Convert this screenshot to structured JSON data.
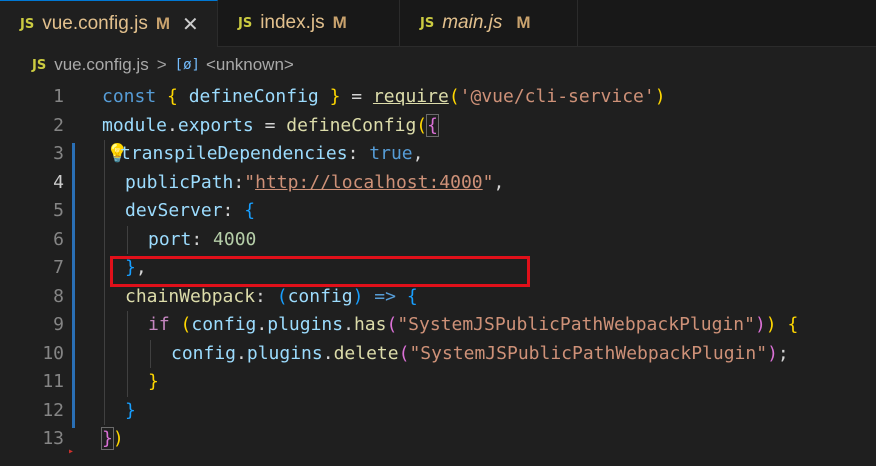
{
  "tabs": [
    {
      "icon": "JS",
      "name": "vue.config.js",
      "status": "M",
      "active": true
    },
    {
      "icon": "JS",
      "name": "index.js",
      "status": "M"
    },
    {
      "icon": "JS",
      "name": "main.js",
      "status": "M"
    }
  ],
  "breadcrumb": {
    "icon": "JS",
    "file": "vue.config.js",
    "separator": ">",
    "symbol_icon": "[ø]",
    "symbol": "<unknown>"
  },
  "lines": {
    "l1": {
      "n": "1",
      "a": "const",
      "b": " ",
      "c": "{",
      "d": " defineConfig ",
      "e": "}",
      "f": " = ",
      "g": "require",
      "h": "(",
      "i": "'@vue/cli-service'",
      "j": ")"
    },
    "l2": {
      "n": "2",
      "a": "module",
      "b": ".",
      "c": "exports",
      "d": " = ",
      "e": "defineConfig",
      "f": "(",
      "g": "{"
    },
    "l3": {
      "n": "3",
      "a": "transpileDependencies",
      "b": ": ",
      "c": "true",
      "d": ","
    },
    "l4": {
      "n": "4",
      "a": "publicPath",
      "b": ":",
      "c": "\"",
      "d": "http://localhost:4000",
      "e": "\"",
      "f": ","
    },
    "l5": {
      "n": "5",
      "a": "devServer",
      "b": ": ",
      "c": "{"
    },
    "l6": {
      "n": "6",
      "a": "port",
      "b": ": ",
      "c": "4000"
    },
    "l7": {
      "n": "7",
      "a": "}",
      "b": ","
    },
    "l8": {
      "n": "8",
      "a": "chainWebpack",
      "b": ": ",
      "c": "(",
      "d": "config",
      "e": ")",
      "f": " => ",
      "g": "{"
    },
    "l9": {
      "n": "9",
      "a": "if",
      "b": " ",
      "c": "(",
      "d": "config",
      "e": ".",
      "f": "plugins",
      "g": ".",
      "h": "has",
      "i": "(",
      "j": "\"SystemJSPublicPathWebpackPlugin\"",
      "k": ")",
      "l": ")",
      "m": " ",
      "o": "{"
    },
    "l10": {
      "n": "10",
      "a": "config",
      "b": ".",
      "c": "plugins",
      "d": ".",
      "e": "delete",
      "f": "(",
      "g": "\"SystemJSPublicPathWebpackPlugin\"",
      "h": ")",
      "i": ";"
    },
    "l11": {
      "n": "11",
      "a": "}"
    },
    "l12": {
      "n": "12",
      "a": "}"
    },
    "l13": {
      "n": "13",
      "a": "}",
      "b": ")"
    }
  },
  "colors": {
    "keyword": "#569cd6",
    "function": "#dcdcaa",
    "string": "#ce9178",
    "property": "#9cdcfe",
    "number": "#b5cea8",
    "highlight_box": "#e0101a"
  },
  "icons": {
    "lightbulb": "lightbulb-icon",
    "close": "close-icon"
  }
}
